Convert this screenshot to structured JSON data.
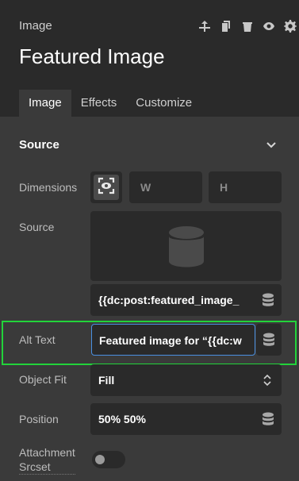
{
  "header": {
    "breadcrumb": "Image",
    "title": "Featured Image",
    "icons": [
      "move-up-icon",
      "copy-icon",
      "delete-icon",
      "visibility-icon",
      "settings-icon"
    ]
  },
  "tabs": [
    {
      "label": "Image",
      "active": true
    },
    {
      "label": "Effects",
      "active": false
    },
    {
      "label": "Customize",
      "active": false
    }
  ],
  "section": {
    "title": "Source"
  },
  "fields": {
    "dimensions": {
      "label": "Dimensions",
      "w_placeholder": "W",
      "h_placeholder": "H"
    },
    "source": {
      "label": "Source",
      "value": "{{dc:post:featured_image_"
    },
    "alt_text": {
      "label": "Alt Text",
      "value": "Featured image for “{{dc:w"
    },
    "object_fit": {
      "label": "Object Fit",
      "value": "Fill"
    },
    "position": {
      "label": "Position",
      "value": "50% 50%"
    },
    "attachment_srcset": {
      "label_line1": "Attachment",
      "label_line2": "Srcset",
      "enabled": false
    }
  },
  "colors": {
    "highlight": "#22d33a",
    "focus_border": "#4a90e2"
  }
}
